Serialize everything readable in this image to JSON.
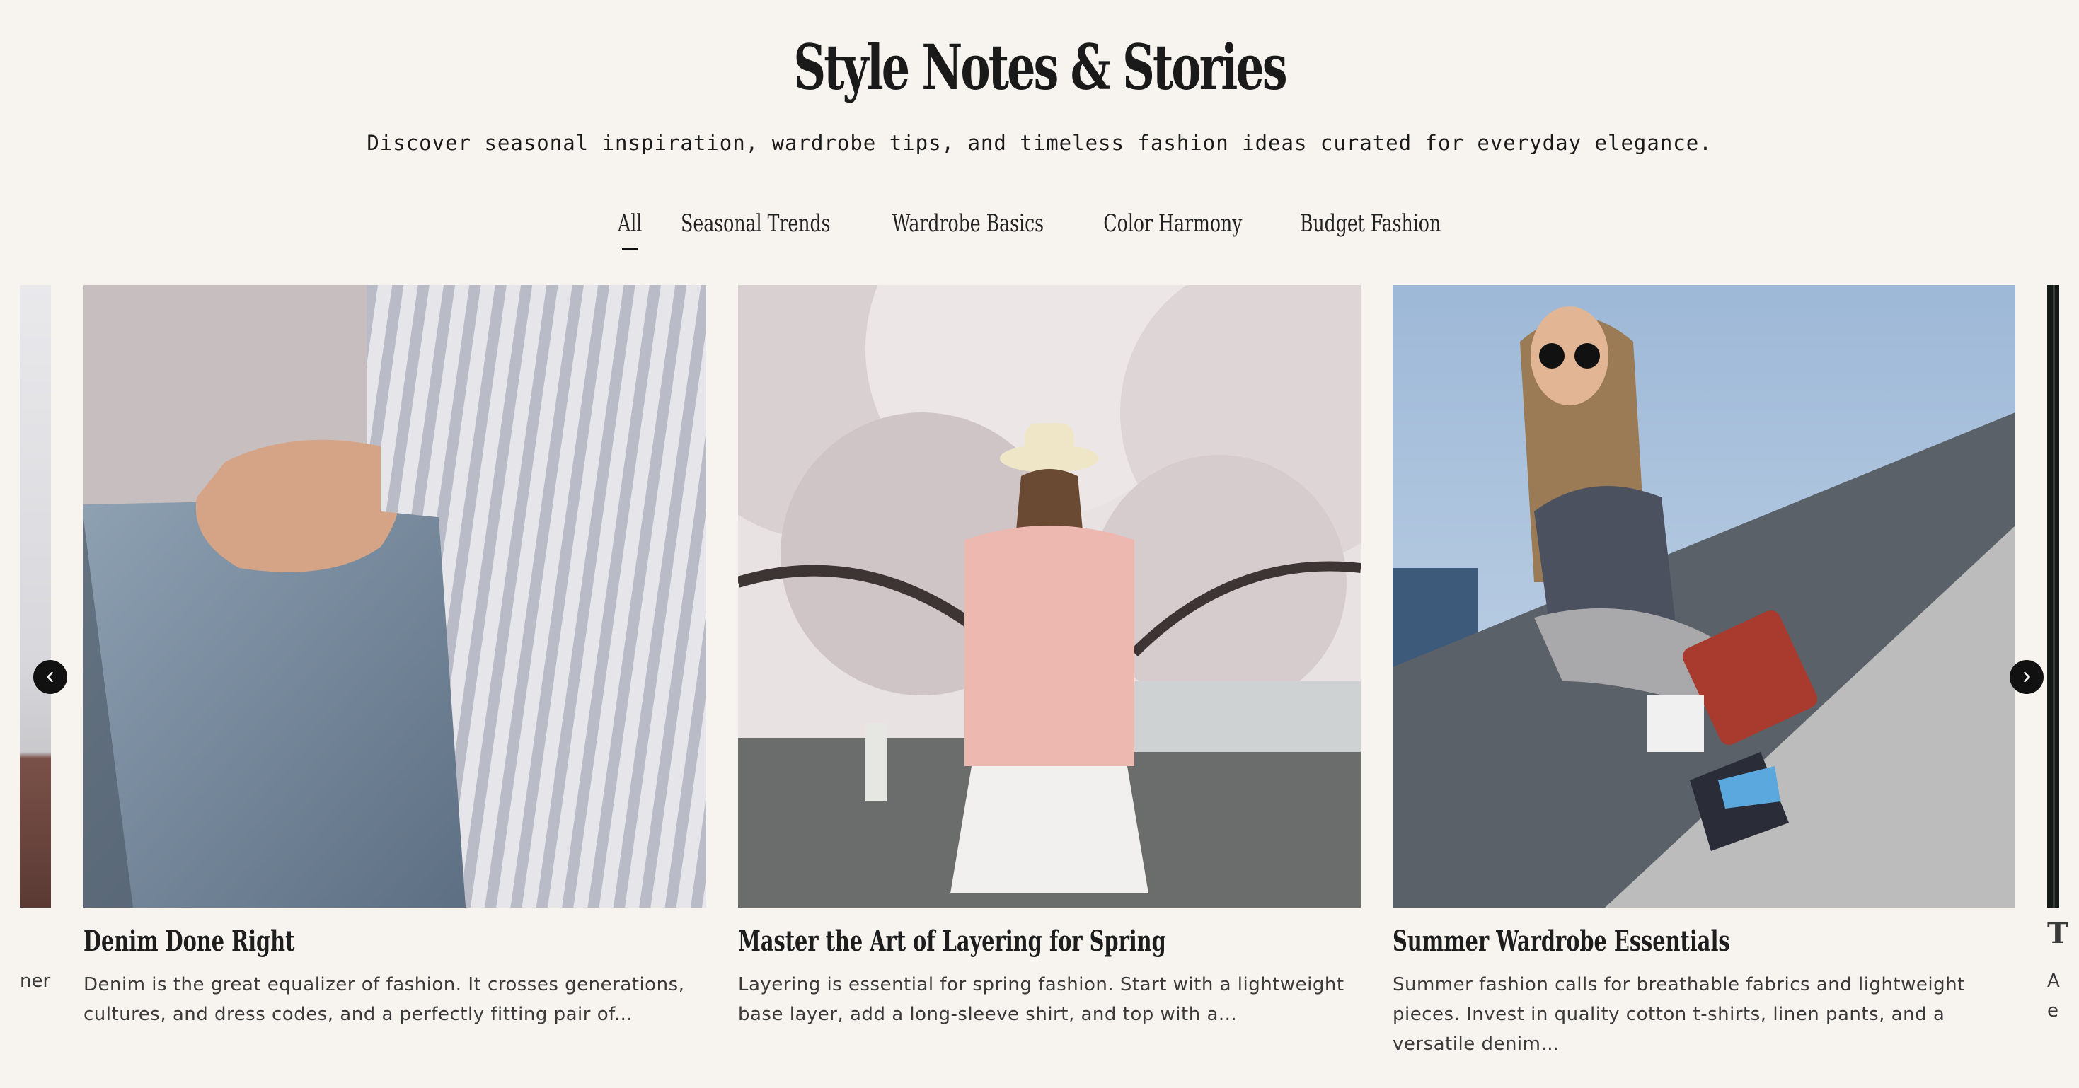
{
  "header": {
    "title": "Style Notes & Stories",
    "subtitle": "Discover seasonal inspiration, wardrobe tips, and timeless fashion ideas curated for everyday elegance."
  },
  "tabs": [
    {
      "label": "All",
      "active": true
    },
    {
      "label": "Seasonal Trends",
      "active": false
    },
    {
      "label": "Wardrobe Basics",
      "active": false
    },
    {
      "label": "Color Harmony",
      "active": false
    },
    {
      "label": "Budget Fashion",
      "active": false
    }
  ],
  "cards": [
    {
      "title": "Denim Done Right",
      "excerpt": "Denim is the great equalizer of fashion. It crosses generations, cultures, and dress codes, and a perfectly fitting pair of..."
    },
    {
      "title": "Master the Art of Layering for Spring",
      "excerpt": "Layering is essential for spring fashion. Start with a lightweight base layer, add a long-sleeve shirt, and top with a..."
    },
    {
      "title": "Summer Wardrobe Essentials",
      "excerpt": "Summer fashion calls for breathable fabrics and lightweight pieces. Invest in quality cotton t-shirts, linen pants, and a versatile denim..."
    }
  ],
  "partial_left": {
    "fragment": "ner"
  },
  "partial_right": {
    "title_fragment": "T",
    "line1_fragment": "A",
    "line2_fragment": "e"
  },
  "icons": {
    "prev": "chevron-left-icon",
    "next": "chevron-right-icon"
  },
  "colors": {
    "background": "#f7f3ef",
    "text": "#1a1a1a",
    "nav_button": "#111111"
  }
}
